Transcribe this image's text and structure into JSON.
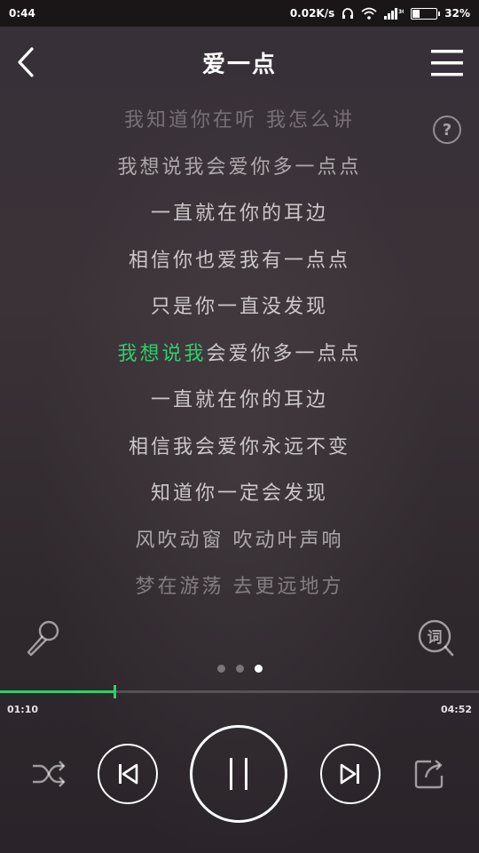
{
  "status_bar": {
    "time": "0:44",
    "net_speed": "0.02K/s",
    "signal_label": "3G",
    "battery_percent": "32%",
    "battery_level": 0.32
  },
  "header": {
    "title": "爱一点"
  },
  "help_label": "?",
  "lyrics": [
    {
      "text": "我知道你在听 我怎么讲",
      "style": "dim1"
    },
    {
      "text": "我想说我会爱你多一点点",
      "style": "dim2"
    },
    {
      "text": "一直就在你的耳边",
      "style": "normal"
    },
    {
      "text": "相信你也爱我有一点点",
      "style": "normal"
    },
    {
      "text": "只是你一直没发现",
      "style": "normal"
    },
    {
      "text_sung": "我想说我",
      "text_rest": "会爱你多一点点",
      "style": "current"
    },
    {
      "text": "一直就在你的耳边",
      "style": "normal"
    },
    {
      "text": "相信我会爱你永远不变",
      "style": "normal"
    },
    {
      "text": "知道你一定会发现",
      "style": "normal"
    },
    {
      "text": "风吹动窗 吹动叶声响",
      "style": "dim2"
    },
    {
      "text": "梦在游荡 去更远地方",
      "style": "fade"
    }
  ],
  "pager": {
    "count": 3,
    "active_index": 2
  },
  "progress": {
    "current": "01:10",
    "total": "04:52",
    "fraction": 0.2397
  },
  "icons": {
    "back": "chevron-left-icon",
    "menu": "hamburger-icon",
    "mic": "microphone-icon",
    "lyric": "lyric-search-icon",
    "shuffle": "shuffle-icon",
    "prev": "skip-previous-icon",
    "pause": "pause-icon",
    "next": "skip-next-icon",
    "share": "share-icon"
  },
  "colors": {
    "accent": "#2fcf6a"
  }
}
